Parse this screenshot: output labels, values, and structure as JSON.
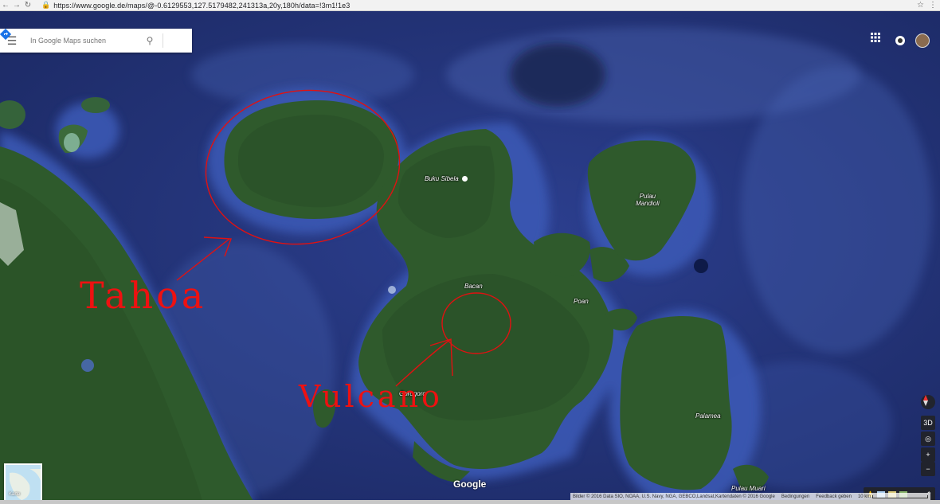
{
  "browser": {
    "url": "https://www.google.de/maps/@-0.6129553,127.5179482,241313a,20y,180h/data=!3m1!1e3",
    "back_icon": "arrow-left-icon",
    "forward_icon": "arrow-right-icon",
    "reload_icon": "reload-icon"
  },
  "search": {
    "placeholder": "In Google Maps suchen",
    "menu_icon": "hamburger-icon",
    "search_icon": "search-icon",
    "directions_icon": "directions-icon"
  },
  "places": {
    "buku_sibela": "Buku Sibela",
    "pulau_mandioli": "Pulau\nMandioli",
    "bacan": "Bacan",
    "poan": "Poan",
    "gorogoro": "Gorogoro",
    "palamea": "Palamea",
    "pulau_muari": "Pulau Muari"
  },
  "annotations": {
    "tahoa": "Tahoa",
    "vulcano": "Vulcano",
    "color": "#e11111"
  },
  "controls": {
    "compass_icon": "compass-icon",
    "tilt_label": "3D",
    "location_icon": "my-location-icon",
    "zoom_in": "+",
    "zoom_out": "−"
  },
  "minimap": {
    "label": "Karte"
  },
  "footer": {
    "logo": "Google",
    "imagery": "Bilder © 2016 Data SIO, NOAA, U.S. Navy, NGA, GEBCO,Landsat,Kartendaten © 2016 Google",
    "terms": "Bedingungen",
    "feedback": "Feedback geben",
    "scale": "10 km"
  },
  "colors": {
    "ocean_deep": "#1b2a6e",
    "ocean_shallow": "#3d5bb5",
    "land": "#2f5a2c",
    "land_dark": "#244a23"
  }
}
